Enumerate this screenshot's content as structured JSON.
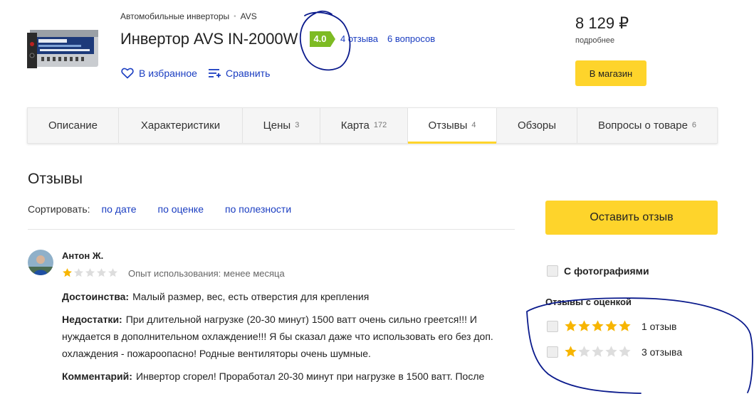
{
  "breadcrumb": {
    "category": "Автомобильные инверторы",
    "separator": "•",
    "brand": "AVS"
  },
  "product": {
    "title": "Инвертор AVS IN-2000W",
    "rating": "4.0",
    "reviews_link": "4 отзыва",
    "questions_link": "6 вопросов",
    "favorites_label": "В избранное",
    "compare_label": "Сравнить",
    "image_icon": "inverter-product-icon"
  },
  "offer": {
    "price": "8 129 ₽",
    "more_label": "подробнее",
    "shop_button": "В магазин"
  },
  "tabs": [
    {
      "label": "Описание",
      "count": ""
    },
    {
      "label": "Характеристики",
      "count": ""
    },
    {
      "label": "Цены",
      "count": "3"
    },
    {
      "label": "Карта",
      "count": "172"
    },
    {
      "label": "Отзывы",
      "count": "4",
      "active": true
    },
    {
      "label": "Обзоры",
      "count": ""
    },
    {
      "label": "Вопросы о товаре",
      "count": "6"
    }
  ],
  "reviews": {
    "title": "Отзывы",
    "sort_label": "Сортировать:",
    "sort_options": [
      "по дате",
      "по оценке",
      "по полезности"
    ],
    "items": [
      {
        "author": "Антон Ж.",
        "rating": 1,
        "max_rating": 5,
        "experience": "Опыт использования: менее месяца",
        "pros_label": "Достоинства:",
        "pros": "Малый размер, вес, есть отверстия для крепления",
        "cons_label": "Недостатки:",
        "cons": "При длительной нагрузке (20-30 минут) 1500 ватт очень сильно греется!!! И нуждается в дополнительном охлаждение!!! Я бы сказал даже что использовать его без доп. охлаждения - пожароопасно! Родные вентиляторы очень шумные.",
        "comment_label": "Комментарий:",
        "comment": "Инвертор сгорел! Проработал 20-30 минут при нагрузке в 1500 ватт. После"
      }
    ]
  },
  "sidebar": {
    "leave_review": "Оставить отзыв",
    "photo_filter": "С фотографиями",
    "rated_heading": "Отзывы с оценкой",
    "rating_filters": [
      {
        "stars": 5,
        "count_label": "1 отзыв"
      },
      {
        "stars": 1,
        "count_label": "3 отзыва"
      }
    ]
  },
  "colors": {
    "accent_yellow": "#fed42b",
    "rating_green": "#7dbb23",
    "link_blue": "#1a3dc1",
    "star_filled": "#f7b500",
    "star_empty": "#dddddd",
    "annotation_ink": "#0a1a8c"
  }
}
